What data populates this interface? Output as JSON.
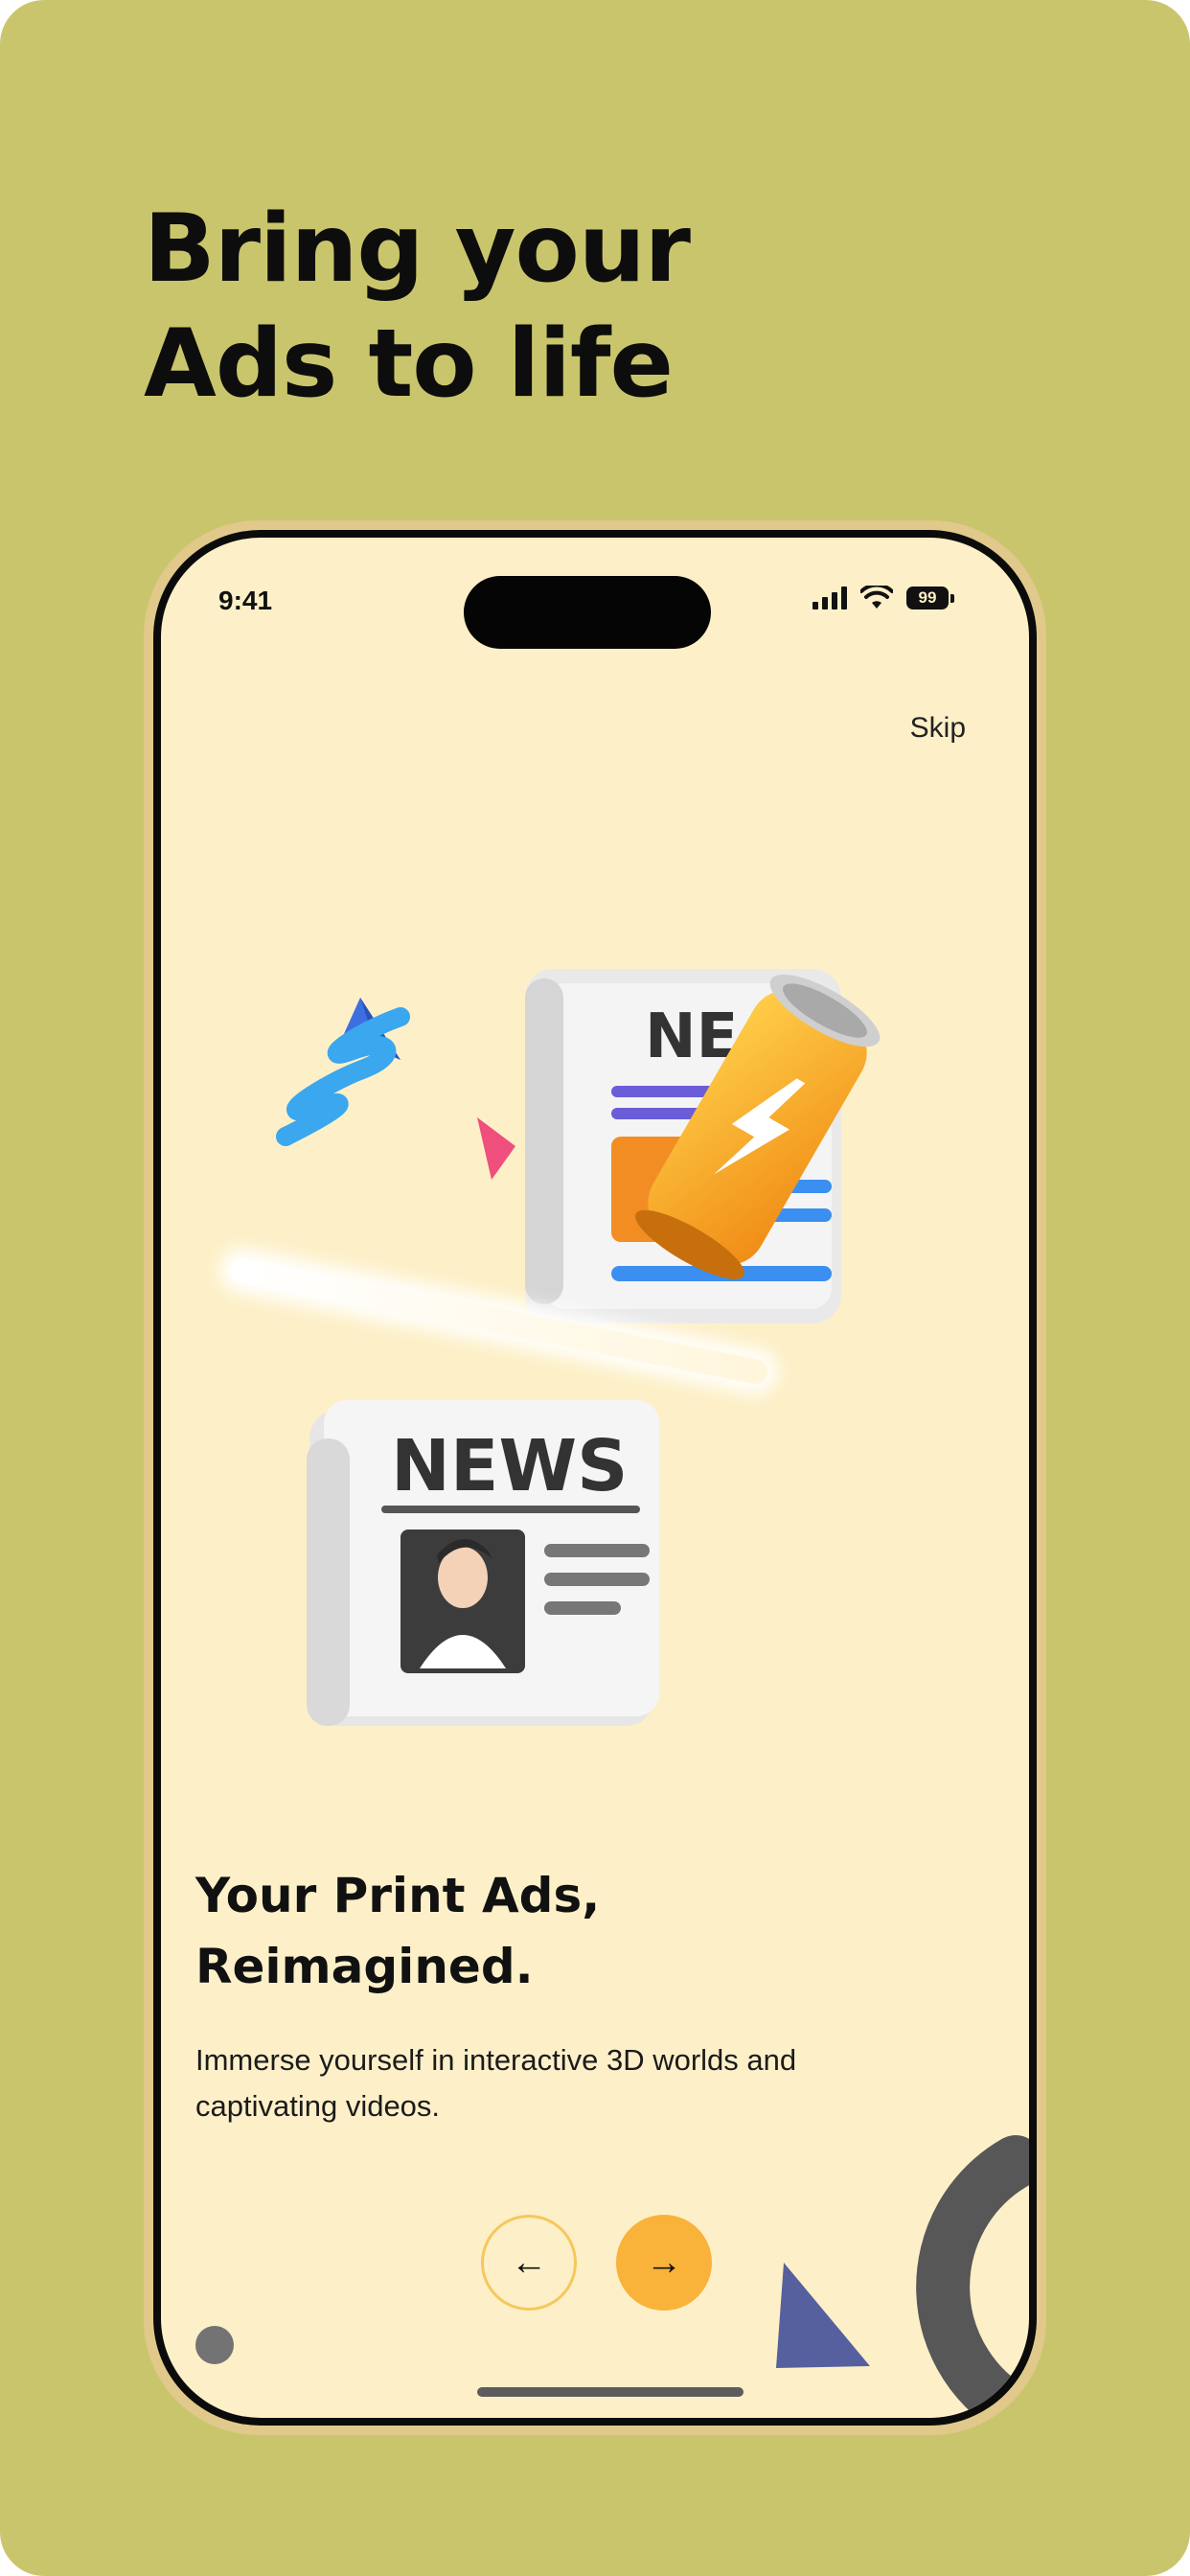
{
  "promo": {
    "headline_line1": "Bring your",
    "headline_line2": "Ads to life"
  },
  "status_bar": {
    "time": "9:41",
    "battery": "99"
  },
  "onboarding": {
    "skip_label": "Skip",
    "title_line1": "Your Print Ads,",
    "title_line2": "Reimagined.",
    "description": "Immerse yourself in interactive 3D worlds and captivating videos.",
    "newspaper_back_text": "NE",
    "newspaper_front_text": "NEWS",
    "prev_icon": "arrow-left-icon",
    "next_icon": "arrow-right-icon",
    "prev_glyph": "←",
    "next_glyph": "→"
  },
  "colors": {
    "background": "#c9c56c",
    "screen": "#fdf0c8",
    "accent": "#f9b23a"
  }
}
